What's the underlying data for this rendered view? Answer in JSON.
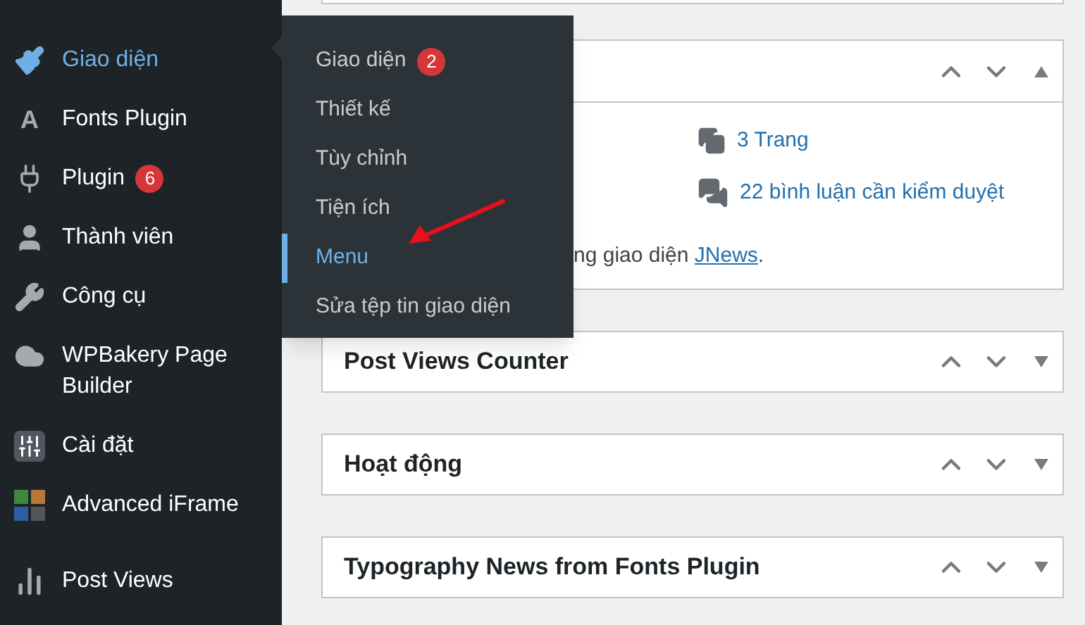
{
  "sidebar": {
    "items": [
      {
        "label": "Giao diện",
        "selected": true
      },
      {
        "label": "Fonts Plugin",
        "icon_text": "A",
        "selected": false
      },
      {
        "label": "Plugin",
        "badge": "6",
        "selected": false
      },
      {
        "label": "Thành viên",
        "selected": false
      },
      {
        "label": "Công cụ",
        "selected": false
      },
      {
        "label": "WPBakery Page Builder",
        "selected": false
      },
      {
        "label": "Cài đặt",
        "selected": false
      },
      {
        "label": "Advanced iFrame",
        "selected": false
      },
      {
        "label": "Post Views",
        "selected": false
      }
    ]
  },
  "submenu": {
    "items": [
      {
        "label": "Giao diện",
        "badge": "2",
        "selected": false
      },
      {
        "label": "Thiết kế",
        "selected": false
      },
      {
        "label": "Tùy chỉnh",
        "selected": false
      },
      {
        "label": "Tiện ích",
        "selected": false
      },
      {
        "label": "Menu",
        "selected": true
      },
      {
        "label": "Sửa tệp tin giao diện",
        "selected": false
      }
    ]
  },
  "widgets": [
    {
      "expanded": true,
      "stats": [
        "3 Trang",
        "22 bình luận cần kiểm duyệt"
      ],
      "theme_line": {
        "before": "ng giao diện ",
        "link": "JNews",
        "after": "."
      }
    },
    {
      "title": "Post Views Counter",
      "expanded": false
    },
    {
      "title": "Hoạt động",
      "expanded": false
    },
    {
      "title": "Typography News from Fonts Plugin",
      "expanded": false
    }
  ]
}
